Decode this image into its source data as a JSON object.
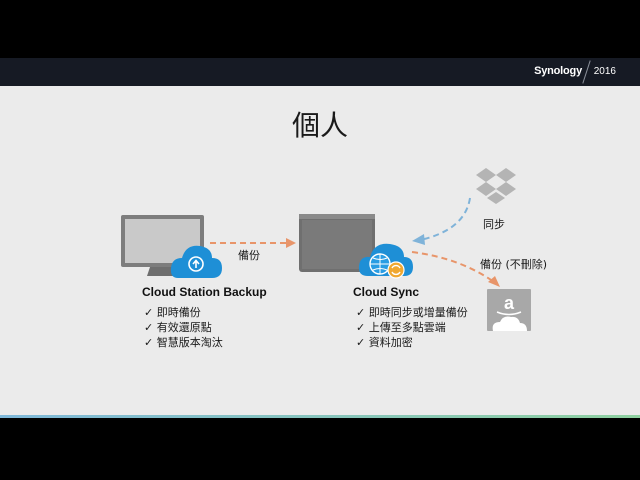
{
  "header": {
    "brand": "Synology",
    "year": "2016"
  },
  "slide": {
    "title": "個人",
    "backup_arrow_label": "備份",
    "sync_label": "同步",
    "backup_nodelete_label": "備份 (不刪除)",
    "left": {
      "heading": "Cloud Station Backup",
      "features": [
        "即時備份",
        "有效還原點",
        "智慧版本淘汰"
      ]
    },
    "right": {
      "heading": "Cloud Sync",
      "features": [
        "即時同步或增量備份",
        "上傳至多點雲端",
        "資料加密"
      ]
    }
  },
  "colors": {
    "accent_cloud": "#1e8fd6",
    "arrow": "#e8956a",
    "arrow_sync": "#7fb3d9"
  }
}
